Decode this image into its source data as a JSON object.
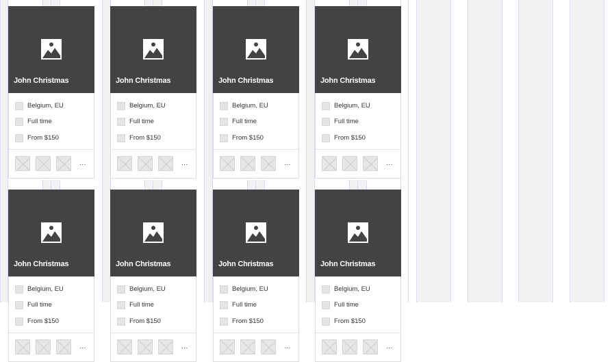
{
  "cards": [
    {
      "name": "John Christmas",
      "location": "Belgium, EU",
      "type": "Full time",
      "price": "From $150",
      "more": "..."
    },
    {
      "name": "John Christmas",
      "location": "Belgium, EU",
      "type": "Full time",
      "price": "From $150",
      "more": "..."
    },
    {
      "name": "John Christmas",
      "location": "Belgium, EU",
      "type": "Full time",
      "price": "From $150",
      "more": "..."
    },
    {
      "name": "John Christmas",
      "location": "Belgium, EU",
      "type": "Full time",
      "price": "From $150",
      "more": "..."
    },
    {
      "name": "John Christmas",
      "location": "Belgium, EU",
      "type": "Full time",
      "price": "From $150",
      "more": "..."
    },
    {
      "name": "John Christmas",
      "location": "Belgium, EU",
      "type": "Full time",
      "price": "From $150",
      "more": "..."
    },
    {
      "name": "John Christmas",
      "location": "Belgium, EU",
      "type": "Full time",
      "price": "From $150",
      "more": "..."
    },
    {
      "name": "John Christmas",
      "location": "Belgium, EU",
      "type": "Full time",
      "price": "From $150",
      "more": "..."
    }
  ],
  "colors": {
    "hero_bg": "#414344",
    "column_bg": "#f1f1f1",
    "column_border": "#d6d9ef"
  },
  "icons": {
    "hero": "image-placeholder-icon",
    "row": "checkbox-icon",
    "thumb": "image-placeholder-thumb-icon"
  }
}
